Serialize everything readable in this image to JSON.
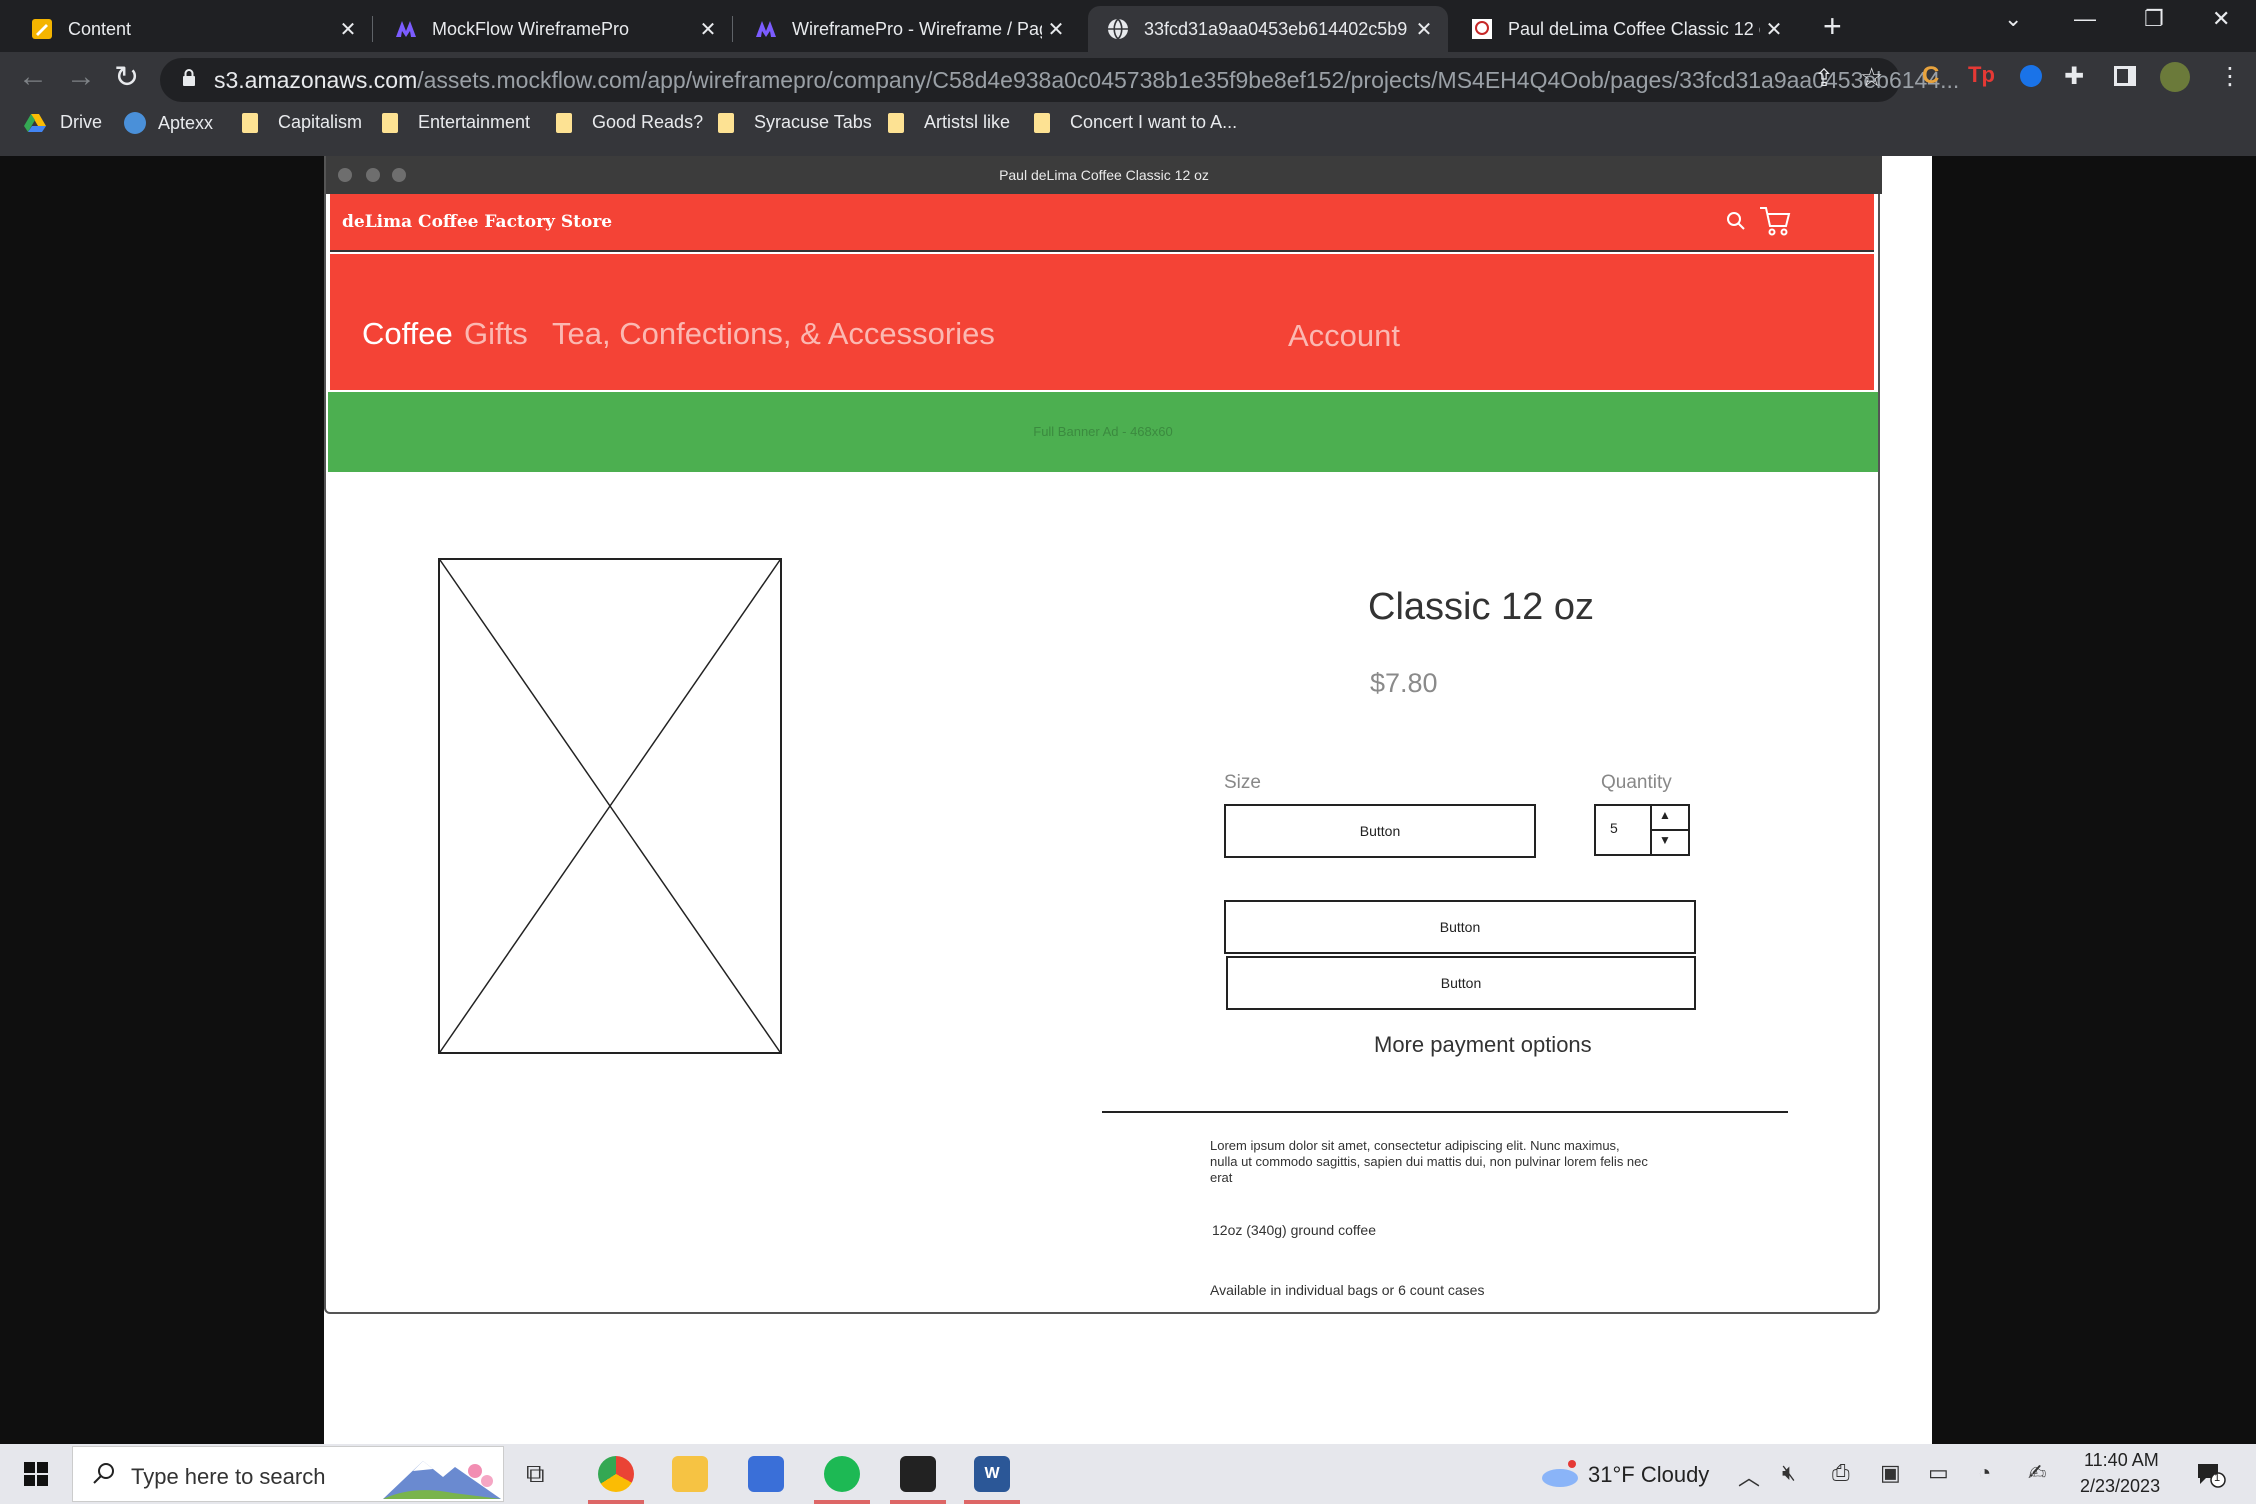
{
  "browser": {
    "tabs": [
      {
        "title": "Content",
        "icon": "notes-icon"
      },
      {
        "title": "MockFlow WireframePro",
        "icon": "mockflow-icon"
      },
      {
        "title": "WireframePro - Wireframe / Pag",
        "icon": "mockflow-icon"
      },
      {
        "title": "33fcd31a9aa0453eb614402c5b9",
        "icon": "globe-icon"
      },
      {
        "title": "Paul deLima Coffee Classic 12 oz",
        "icon": "delima-icon"
      }
    ],
    "url_host": "s3.amazonaws.com",
    "url_path": "/assets.mockflow.com/app/wireframepro/company/C58d4e938a0c045738b1e35f9be8ef152/projects/MS4EH4Q4Oob/pages/33fcd31a9aa0453eb6144...",
    "bookmarks": [
      "Drive",
      "Aptexx",
      "Capitalism",
      "Entertainment",
      "Good Reads?",
      "Syracuse Tabs",
      "Artistsl like",
      "Concert I want to A..."
    ]
  },
  "window": {
    "title": "Paul deLima Coffee Classic  12 oz"
  },
  "store": {
    "name": "deLima Coffee Factory Store",
    "nav": [
      "Coffee",
      "Gifts",
      "Tea, Confections, & Accessories"
    ],
    "account": "Account",
    "banner": "Full Banner Ad - 468x60"
  },
  "product": {
    "title": "Classic 12 oz",
    "price": "$7.80",
    "size_label": "Size",
    "quantity_label": "Quantity",
    "size_button": "Button",
    "quantity": "5",
    "buy_button_1": "Button",
    "buy_button_2": "Button",
    "more_payment": "More payment options",
    "description": "Lorem ipsum dolor sit amet, consectetur adipiscing elit. Nunc maximus, nulla ut commodo sagittis, sapien dui mattis dui, non pulvinar lorem felis nec erat",
    "detail_1": "12oz (340g) ground coffee",
    "detail_2": "Available in individual bags or 6 count cases"
  },
  "colors": {
    "header": "#f44336",
    "banner": "#4caf50",
    "tab_bg": "#1f2023",
    "toolbar": "#35363a"
  },
  "taskbar": {
    "search_placeholder": "Type here to search",
    "weather": "31°F  Cloudy",
    "time": "11:40 AM",
    "date": "2/23/2023",
    "notifications": "1"
  }
}
